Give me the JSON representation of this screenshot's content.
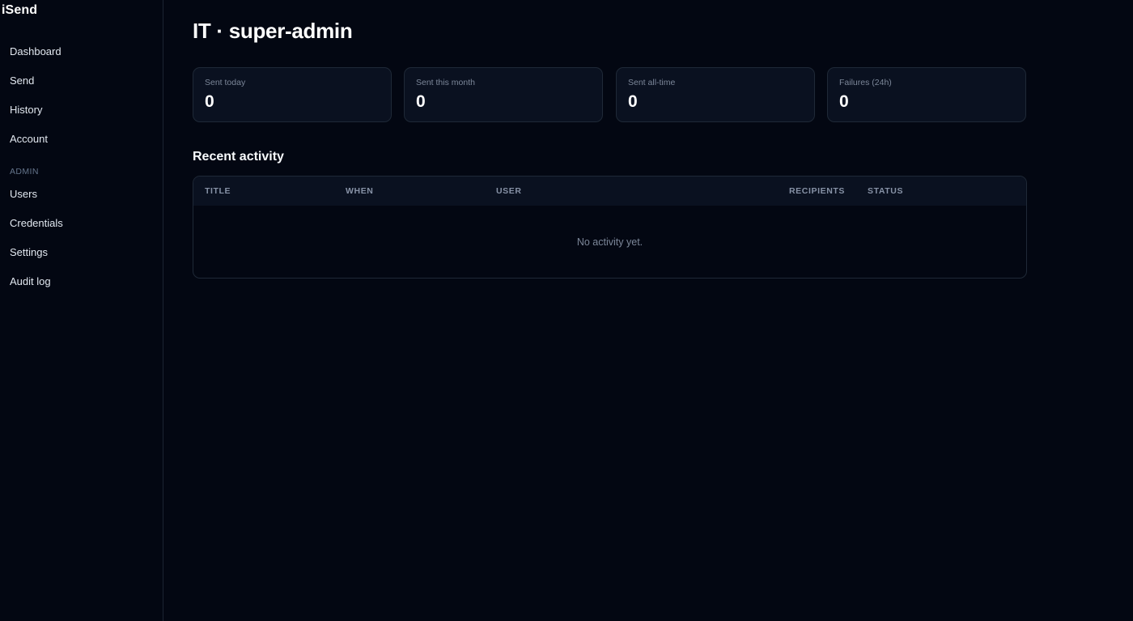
{
  "app": {
    "brand": "iSend"
  },
  "sidebar": {
    "items": [
      {
        "label": "Dashboard"
      },
      {
        "label": "Send"
      },
      {
        "label": "History"
      },
      {
        "label": "Account"
      }
    ],
    "admin_section_label": "ADMIN",
    "admin_items": [
      {
        "label": "Users"
      },
      {
        "label": "Credentials"
      },
      {
        "label": "Settings"
      },
      {
        "label": "Audit log"
      }
    ]
  },
  "main": {
    "title": "IT · super-admin",
    "stats": [
      {
        "label": "Sent today",
        "value": "0"
      },
      {
        "label": "Sent this month",
        "value": "0"
      },
      {
        "label": "Sent all-time",
        "value": "0"
      },
      {
        "label": "Failures (24h)",
        "value": "0"
      }
    ],
    "recent_activity": {
      "title": "Recent activity",
      "columns": [
        "TITLE",
        "WHEN",
        "USER",
        "RECIPIENTS",
        "STATUS"
      ],
      "rows": [],
      "empty_message": "No activity yet."
    }
  }
}
